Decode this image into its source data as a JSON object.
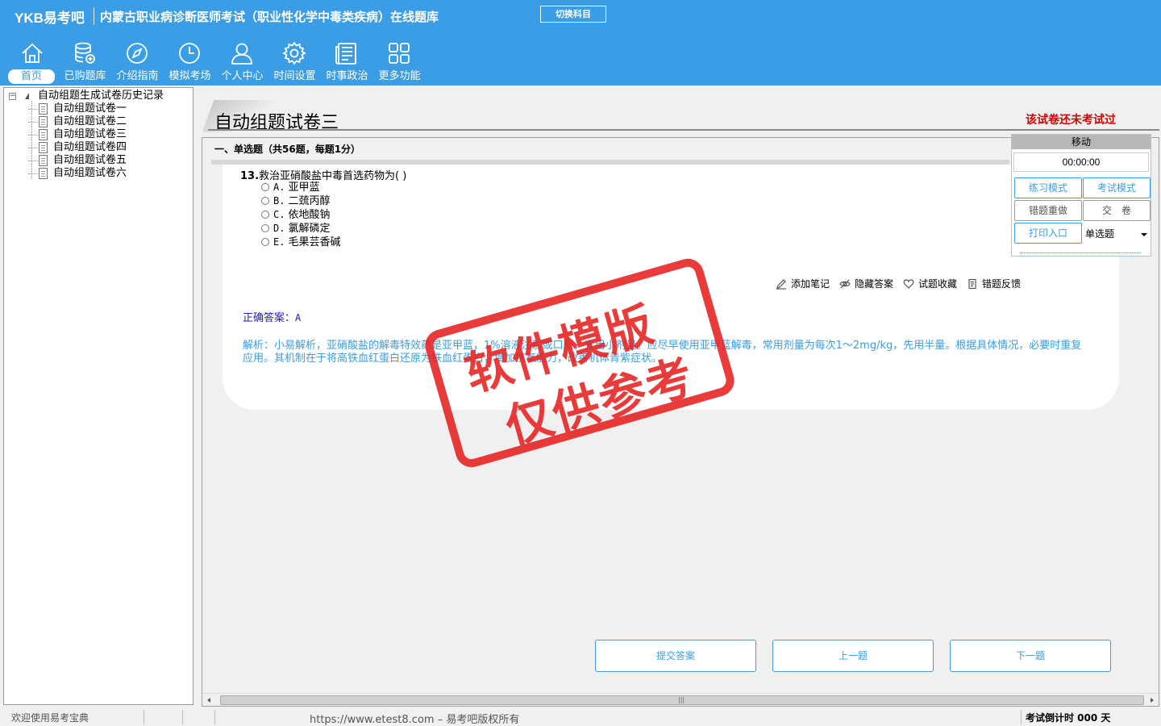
{
  "header": {
    "logo": "YKB易考吧",
    "title": "内蒙古职业病诊断医师考试（职业性化学中毒类疾病）在线题库",
    "switch_subject": "切换科目"
  },
  "nav": [
    {
      "label": "首页",
      "icon": "home-icon",
      "active": true
    },
    {
      "label": "已购题库",
      "icon": "database-icon"
    },
    {
      "label": "介绍指南",
      "icon": "compass-icon"
    },
    {
      "label": "模拟考场",
      "icon": "clock-icon"
    },
    {
      "label": "个人中心",
      "icon": "user-icon"
    },
    {
      "label": "时间设置",
      "icon": "gear-icon"
    },
    {
      "label": "时事政治",
      "icon": "newspaper-icon"
    },
    {
      "label": "更多功能",
      "icon": "grid-icon"
    }
  ],
  "sidebar": {
    "root": "自动组题生成试卷历史记录",
    "toggle": "−",
    "items": [
      "自动组题试卷一",
      "自动组题试卷二",
      "自动组题试卷三",
      "自动组题试卷四",
      "自动组题试卷五",
      "自动组题试卷六"
    ]
  },
  "main": {
    "title": "自动组题试卷三",
    "status": "该试卷还未考试过",
    "section": "一、单选题（共56题，每题1分）",
    "question": {
      "number": "13.",
      "text": "救治亚硝酸盐中毒首选药物为( )",
      "options": [
        {
          "letter": "A.",
          "text": "亚甲蓝"
        },
        {
          "letter": "B.",
          "text": "二巯丙醇"
        },
        {
          "letter": "C.",
          "text": "依地酸钠"
        },
        {
          "letter": "D.",
          "text": "氯解磷定"
        },
        {
          "letter": "E.",
          "text": "毛果芸香碱"
        }
      ]
    },
    "tools": {
      "add_note": "添加笔记",
      "hide_answer": "隐藏答案",
      "favorite": "试题收藏",
      "feedback": "错题反馈"
    },
    "answer_label": "正确答案：",
    "answer_value": "A",
    "analysis": "解析：小易解析，亚硝酸盐的解毒特效药是亚甲蓝，1%溶液注射或口服，宜用小剂量。应尽早使用亚甲蓝解毒，常用剂量为每次1～2mg/kg，先用半量。根据具体情况，必要时重复应用。其机制在于将高铁血红蛋白还原为铁血红蛋白，增加携氧能力，改善机体青紫症状。"
  },
  "panel": {
    "move": "移动",
    "timer": "00:00:00",
    "practice_mode": "练习模式",
    "exam_mode": "考试模式",
    "redo_wrong": "错题重做",
    "submit_paper": "交　卷",
    "print": "打印入口",
    "question_type": "单选题"
  },
  "buttons": {
    "submit": "提交答案",
    "prev": "上一题",
    "next": "下一题"
  },
  "statusbar": {
    "welcome": "欢迎使用易考宝典",
    "url": "https://www.etest8.com – 易考吧版权所有",
    "countdown": "考试倒计时 000 天"
  },
  "watermark": {
    "line1": "软件模版",
    "line2": "仅供参考"
  },
  "colors": {
    "brand": "#3a9de6",
    "alert": "#d40000",
    "stamp": "#e82020"
  }
}
